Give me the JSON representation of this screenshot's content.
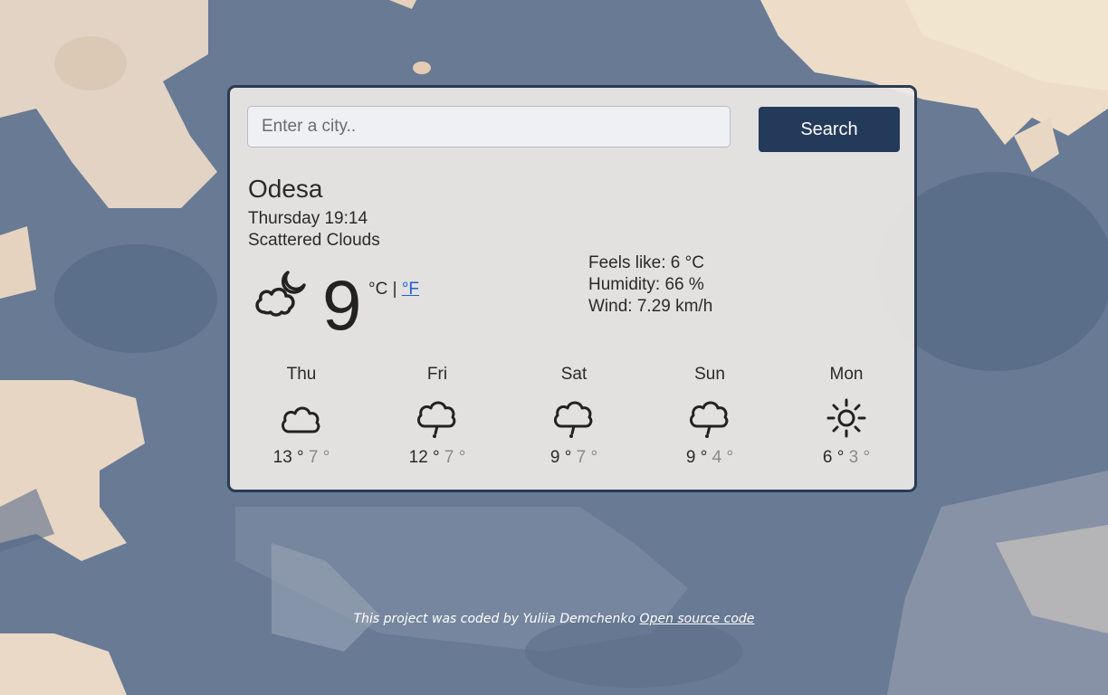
{
  "search": {
    "placeholder": "Enter a city..",
    "button_label": "Search"
  },
  "current": {
    "city": "Odesa",
    "datetime": "Thursday 19:14",
    "description": "Scattered Clouds",
    "icon": "partly-cloudy-night-icon",
    "temperature": "9",
    "unit_c": "°C",
    "unit_sep": "|",
    "unit_f": "°F",
    "feels_like": "Feels like: 6 °C",
    "humidity": "Humidity: 66 %",
    "wind": "Wind: 7.29 km/h"
  },
  "forecast": [
    {
      "day": "Thu",
      "icon": "cloud-icon",
      "max": "13 °",
      "min": "7 °"
    },
    {
      "day": "Fri",
      "icon": "rain-cloud-icon",
      "max": "12 °",
      "min": "7 °"
    },
    {
      "day": "Sat",
      "icon": "rain-cloud-icon",
      "max": "9 °",
      "min": "7 °"
    },
    {
      "day": "Sun",
      "icon": "rain-cloud-icon",
      "max": "9 °",
      "min": "4 °"
    },
    {
      "day": "Mon",
      "icon": "sun-icon",
      "max": "6 °",
      "min": "3 °"
    }
  ],
  "footer": {
    "text": "This project was coded by Yuliia Demchenko",
    "link": "Open source code"
  },
  "colors": {
    "accent": "#243a5b",
    "link": "#1f5fd6",
    "card_border": "#2a3b54"
  }
}
